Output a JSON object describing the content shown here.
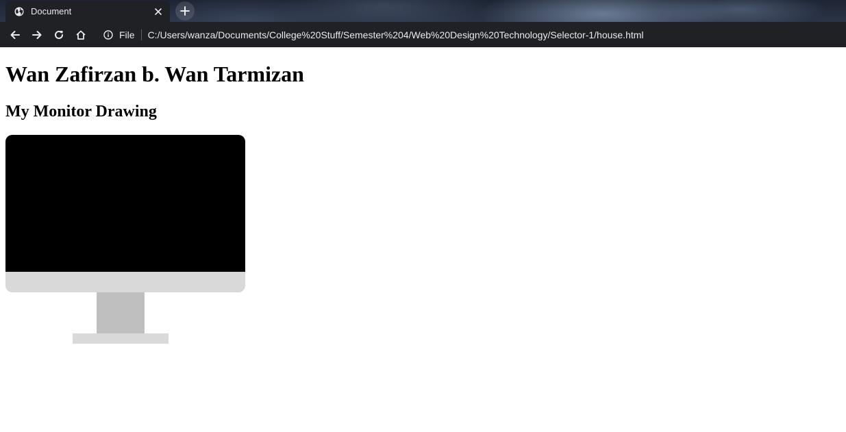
{
  "browser": {
    "tab": {
      "title": "Document",
      "favicon": "globe-icon",
      "close_icon": "close-icon"
    },
    "new_tab_icon": "plus-icon",
    "toolbar": {
      "back_icon": "arrow-left-icon",
      "forward_icon": "arrow-right-icon",
      "reload_icon": "reload-icon",
      "home_icon": "home-icon",
      "info_icon": "info-icon",
      "scheme_label": "File",
      "url": "C:/Users/wanza/Documents/College%20Stuff/Semester%204/Web%20Design%20Technology/Selector-1/house.html"
    }
  },
  "page": {
    "heading": "Wan Zafirzan b. Wan Tarmizan",
    "subheading": "My Monitor Drawing",
    "monitor": {
      "screen_color": "#000000",
      "chin_color": "#d9d9d9",
      "neck_color": "#bfbfbf",
      "base_color": "#d9d9d9"
    }
  },
  "colors": {
    "chrome_dark": "#202124",
    "chrome_text": "#e8eaed",
    "page_bg": "#ffffff"
  }
}
